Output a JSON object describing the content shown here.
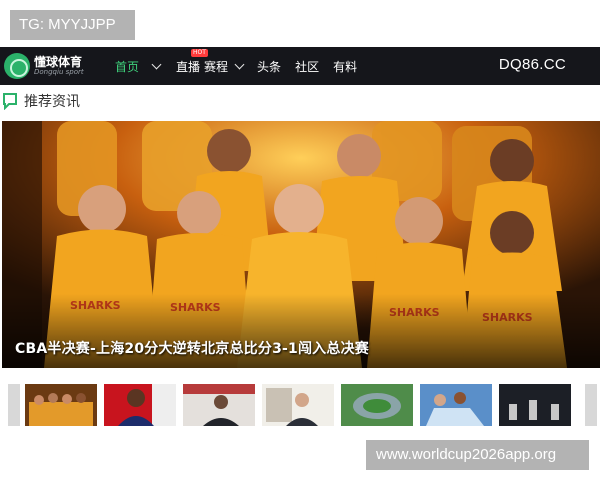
{
  "tag_overlay": "TG: MYYJJPP",
  "navbar": {
    "logo_cn": "懂球体育",
    "logo_en": "Dongqiu sport",
    "home": "首页",
    "live": "直播",
    "live_badge": "HOT",
    "schedule": "赛程",
    "headlines": "头条",
    "community": "社区",
    "info": "有料",
    "domain": "DQ86.CC",
    "colors": {
      "background": "#15161b",
      "active": "#3fd27c"
    }
  },
  "section": {
    "title": "推荐资讯",
    "icon": "message-icon"
  },
  "hero": {
    "caption": "CBA半决赛-上海20分大逆转北京总比分3-1闯入总决赛",
    "jersey_text": "SHARKS",
    "colors": {
      "jersey": "#f2a51f",
      "background": "#2a1406"
    }
  },
  "thumbnails": [
    "team-photo",
    "player-portrait",
    "press-conference",
    "coach-interview",
    "stadium-aerial",
    "team-celebration",
    "award-ceremony"
  ],
  "watermark": "www.worldcup2026app.org"
}
